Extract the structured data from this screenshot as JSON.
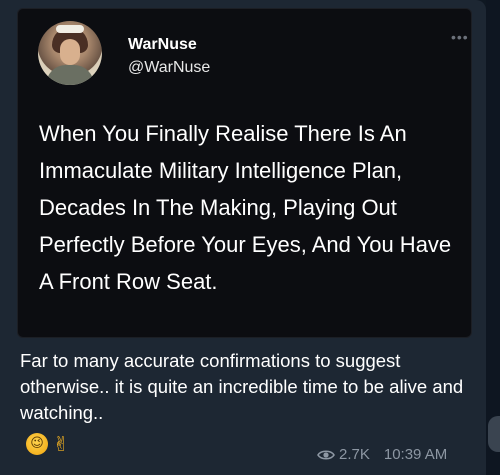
{
  "tweet": {
    "display_name": "WarNuse",
    "handle": "@WarNuse",
    "more_icon": "more-options-icon",
    "text": "When You Finally Realise There Is An Immaculate Military Intelligence Plan, Decades In The Making, Playing Out Perfectly Before Your Eyes, And You Have A Front Row Seat."
  },
  "message": {
    "text": "Far to many accurate confirmations to suggest otherwise.. it is quite an incredible time to be alive and watching..",
    "emojis": [
      "winking-face",
      "victory-hand"
    ],
    "views": "2.7K",
    "time": "10:39 AM"
  },
  "colors": {
    "bubble": "#1d2733",
    "card": "#0c0d11",
    "meta_text": "#8d97a3"
  }
}
